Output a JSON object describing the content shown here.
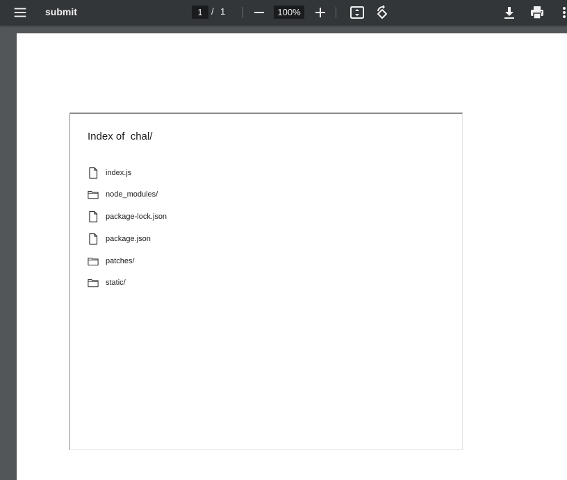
{
  "toolbar": {
    "title": "submit",
    "page_current": "1",
    "page_separator": "/",
    "page_total": "1",
    "zoom": "100%"
  },
  "document": {
    "heading": "Index of  chal/",
    "entries": [
      {
        "name": "index.js",
        "kind": "file"
      },
      {
        "name": "node_modules/",
        "kind": "folder"
      },
      {
        "name": "package-lock.json",
        "kind": "file"
      },
      {
        "name": "package.json",
        "kind": "file"
      },
      {
        "name": "patches/",
        "kind": "folder"
      },
      {
        "name": "static/",
        "kind": "folder"
      }
    ]
  },
  "colors": {
    "toolbar_bg": "#323639",
    "viewer_bg": "#525659",
    "page_bg": "#ffffff"
  },
  "icons": [
    "menu-icon",
    "zoom-out-icon",
    "zoom-in-icon",
    "fit-to-page-icon",
    "rotate-icon",
    "download-icon",
    "print-icon",
    "more-vert-icon",
    "file-icon",
    "folder-icon"
  ]
}
